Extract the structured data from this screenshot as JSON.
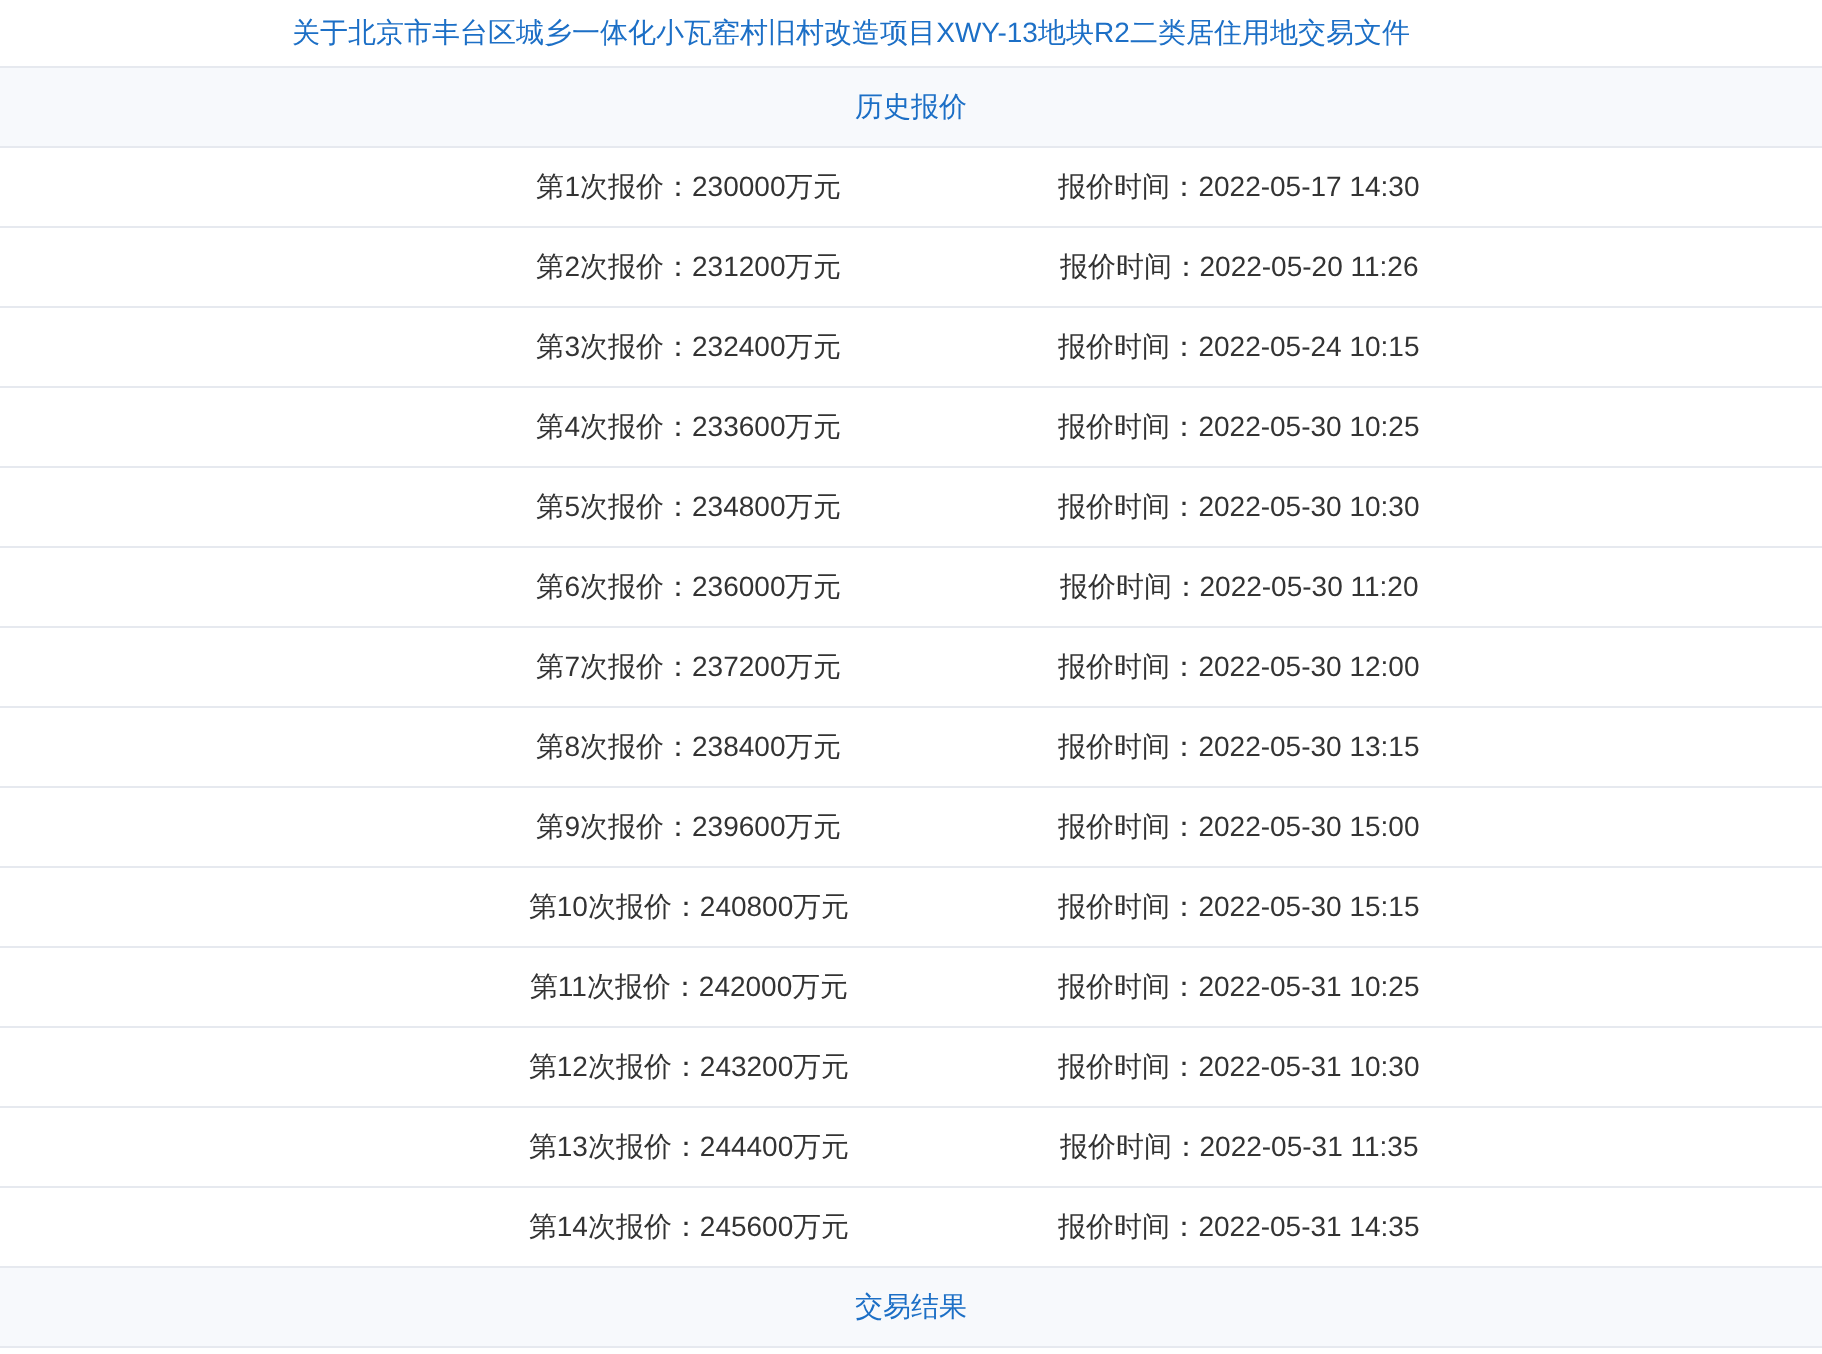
{
  "document_link": "关于北京市丰台区城乡一体化小瓦窑村旧村改造项目XWY-13地块R2二类居住用地交易文件",
  "history_section": {
    "title": "历史报价",
    "rows": [
      {
        "price": "第1次报价：230000万元",
        "time": "报价时间：2022-05-17 14:30"
      },
      {
        "price": "第2次报价：231200万元",
        "time": "报价时间：2022-05-20 11:26"
      },
      {
        "price": "第3次报价：232400万元",
        "time": "报价时间：2022-05-24 10:15"
      },
      {
        "price": "第4次报价：233600万元",
        "time": "报价时间：2022-05-30 10:25"
      },
      {
        "price": "第5次报价：234800万元",
        "time": "报价时间：2022-05-30 10:30"
      },
      {
        "price": "第6次报价：236000万元",
        "time": "报价时间：2022-05-30 11:20"
      },
      {
        "price": "第7次报价：237200万元",
        "time": "报价时间：2022-05-30 12:00"
      },
      {
        "price": "第8次报价：238400万元",
        "time": "报价时间：2022-05-30 13:15"
      },
      {
        "price": "第9次报价：239600万元",
        "time": "报价时间：2022-05-30 15:00"
      },
      {
        "price": "第10次报价：240800万元",
        "time": "报价时间：2022-05-30 15:15"
      },
      {
        "price": "第11次报价：242000万元",
        "time": "报价时间：2022-05-31 10:25"
      },
      {
        "price": "第12次报价：243200万元",
        "time": "报价时间：2022-05-31 10:30"
      },
      {
        "price": "第13次报价：244400万元",
        "time": "报价时间：2022-05-31 11:35"
      },
      {
        "price": "第14次报价：245600万元",
        "time": "报价时间：2022-05-31 14:35"
      }
    ]
  },
  "result_section": {
    "title": "交易结果"
  }
}
